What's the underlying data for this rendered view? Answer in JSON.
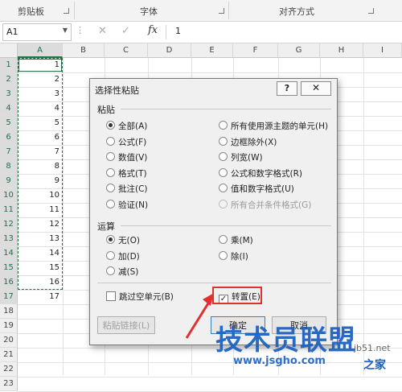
{
  "ribbon": {
    "groups": [
      "剪贴板",
      "字体",
      "对齐方式"
    ]
  },
  "formula_bar": {
    "name_box": "A1",
    "fx_label": "fx",
    "value": "1"
  },
  "grid": {
    "columns": [
      "A",
      "B",
      "C",
      "D",
      "E",
      "F",
      "G",
      "H",
      "I"
    ],
    "rows": [
      "1",
      "2",
      "3",
      "4",
      "5",
      "6",
      "7",
      "8",
      "9",
      "10",
      "11",
      "12",
      "13",
      "14",
      "15",
      "16",
      "17",
      "18",
      "19",
      "20",
      "21",
      "22",
      "23"
    ],
    "col_a_values": [
      "1",
      "2",
      "3",
      "4",
      "5",
      "6",
      "7",
      "8",
      "9",
      "10",
      "11",
      "12",
      "13",
      "14",
      "15",
      "16",
      "17"
    ]
  },
  "dialog": {
    "title": "选择性粘贴",
    "help": "?",
    "close": "✕",
    "paste_section": "粘贴",
    "paste_options_left": [
      "全部(A)",
      "公式(F)",
      "数值(V)",
      "格式(T)",
      "批注(C)",
      "验证(N)"
    ],
    "paste_options_right": [
      "所有使用源主题的单元(H)",
      "边框除外(X)",
      "列宽(W)",
      "公式和数字格式(R)",
      "值和数字格式(U)",
      "所有合并条件格式(G)"
    ],
    "op_section": "运算",
    "op_options_left": [
      "无(O)",
      "加(D)",
      "减(S)"
    ],
    "op_options_right": [
      "乘(M)",
      "除(I)"
    ],
    "skip_blanks": "跳过空单元(B)",
    "transpose": "转置(E)",
    "paste_link": "粘贴链接(L)",
    "ok": "确定",
    "cancel": "取消"
  },
  "watermark": {
    "main": "技术员联盟",
    "site": "www.jsgho.com",
    "side": "jb51.net",
    "tail": "之家"
  },
  "colors": {
    "excel_green": "#217346",
    "highlight_red": "#e03030",
    "watermark_blue": "#1a5fc0"
  }
}
